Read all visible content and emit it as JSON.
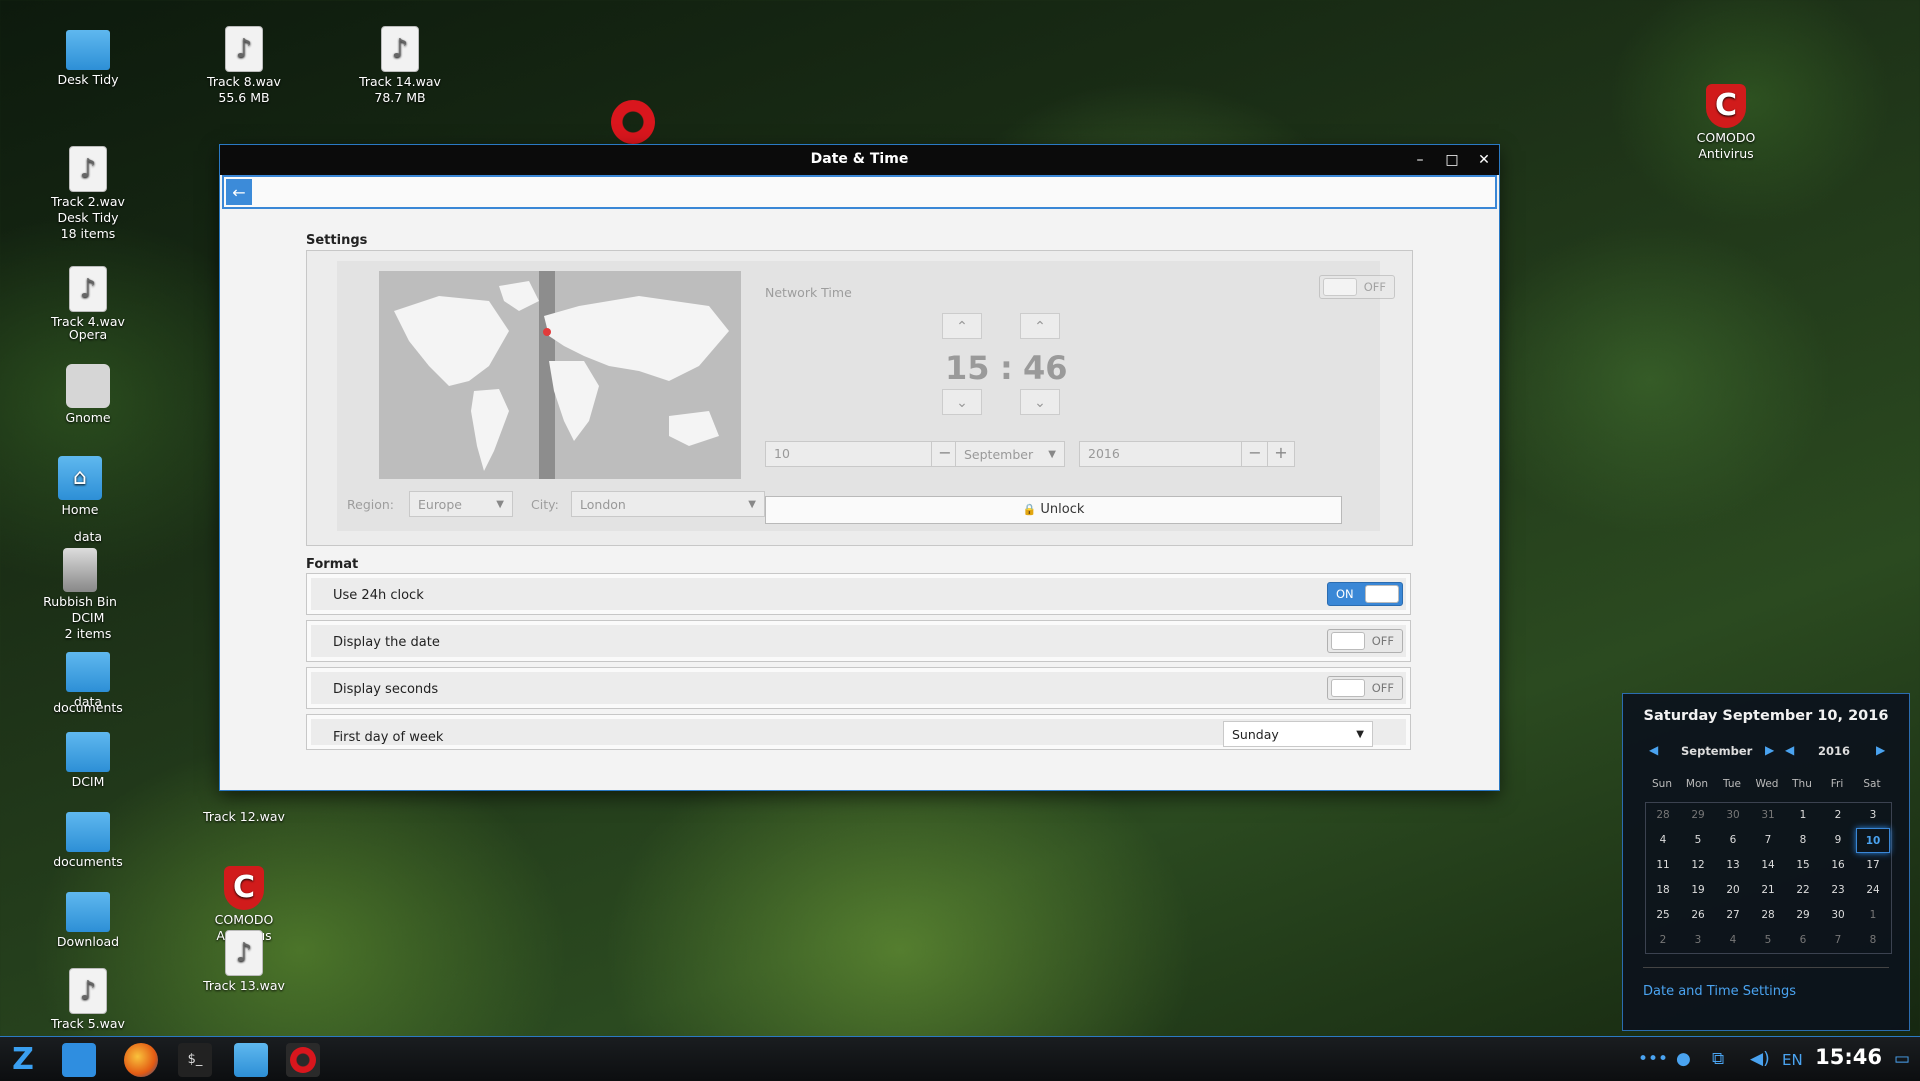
{
  "desktop": {
    "icons": [
      {
        "label": "Desk Tidy",
        "sub": "",
        "kind": "folder"
      },
      {
        "label": "Track 2.wav",
        "sub": "",
        "kind": "file"
      },
      {
        "label": "Desk Tidy",
        "sub": "18 items",
        "kind": "folder"
      },
      {
        "label": "Track 4.wav",
        "sub": "",
        "kind": "file"
      },
      {
        "label": "Opera",
        "sub": "",
        "kind": "opera"
      },
      {
        "label": "Gnome",
        "sub": "",
        "kind": "drive"
      },
      {
        "label": "Home",
        "sub": "",
        "kind": "home"
      },
      {
        "label": "data",
        "sub": "",
        "kind": "folder"
      },
      {
        "label": "Rubbish Bin",
        "sub": "",
        "kind": "bin"
      },
      {
        "label": "DCIM",
        "sub": "2 items",
        "kind": "folder"
      },
      {
        "label": "data",
        "sub": "",
        "kind": "folder"
      },
      {
        "label": "documents",
        "sub": "",
        "kind": "folder"
      },
      {
        "label": "DCIM",
        "sub": "",
        "kind": "folder"
      },
      {
        "label": "documents",
        "sub": "",
        "kind": "folder"
      },
      {
        "label": "Download",
        "sub": "",
        "kind": "folder"
      },
      {
        "label": "Track 5.wav",
        "sub": "",
        "kind": "file"
      },
      {
        "label": "Track 8.wav",
        "sub": "55.6 MB",
        "kind": "file"
      },
      {
        "label": "Track 14.wav",
        "sub": "78.7 MB",
        "kind": "file"
      },
      {
        "label": "Track 12.wav",
        "sub": "",
        "kind": "file"
      },
      {
        "label": "COMODO Antivirus",
        "sub": "",
        "kind": "comodo"
      },
      {
        "label": "Track 13.wav",
        "sub": "",
        "kind": "file"
      },
      {
        "label": "COMODO Antivirus",
        "sub": "",
        "kind": "comodo"
      }
    ]
  },
  "window": {
    "title": "Date & Time",
    "minimize": "–",
    "maximize": "□",
    "close": "✕",
    "back_icon": "←"
  },
  "settings": {
    "heading": "Settings",
    "network_time_label": "Network Time",
    "network_time_state": "OFF",
    "hour": "15",
    "colon": ":",
    "minute": "46",
    "day": "10",
    "month": "September",
    "year": "2016",
    "minus": "−",
    "plus": "+",
    "region_label": "Region:",
    "region_value": "Europe",
    "city_label": "City:",
    "city_value": "London",
    "unlock_label": "Unlock",
    "lock_icon": "🔒"
  },
  "format": {
    "heading": "Format",
    "rows": [
      {
        "label": "Use 24h clock",
        "state": "ON"
      },
      {
        "label": "Display the date",
        "state": "OFF"
      },
      {
        "label": "Display seconds",
        "state": "OFF"
      }
    ],
    "first_day_label": "First day of week",
    "first_day_value": "Sunday"
  },
  "taskbar": {
    "clock": "15:46",
    "lang": "EN",
    "colors": {
      "accent": "#4aa3f0",
      "bar": "#0c0e10"
    }
  },
  "calendar": {
    "header": "Saturday September 10, 2016",
    "month": "September",
    "year": "2016",
    "weekdays": [
      "Sun",
      "Mon",
      "Tue",
      "Wed",
      "Thu",
      "Fri",
      "Sat"
    ],
    "weeks": [
      [
        "28",
        "29",
        "30",
        "31",
        "1",
        "2",
        "3"
      ],
      [
        "4",
        "5",
        "6",
        "7",
        "8",
        "9",
        "10"
      ],
      [
        "11",
        "12",
        "13",
        "14",
        "15",
        "16",
        "17"
      ],
      [
        "18",
        "19",
        "20",
        "21",
        "22",
        "23",
        "24"
      ],
      [
        "25",
        "26",
        "27",
        "28",
        "29",
        "30",
        "1"
      ],
      [
        "2",
        "3",
        "4",
        "5",
        "6",
        "7",
        "8"
      ]
    ],
    "today": "10",
    "settings_link": "Date and Time Settings"
  }
}
